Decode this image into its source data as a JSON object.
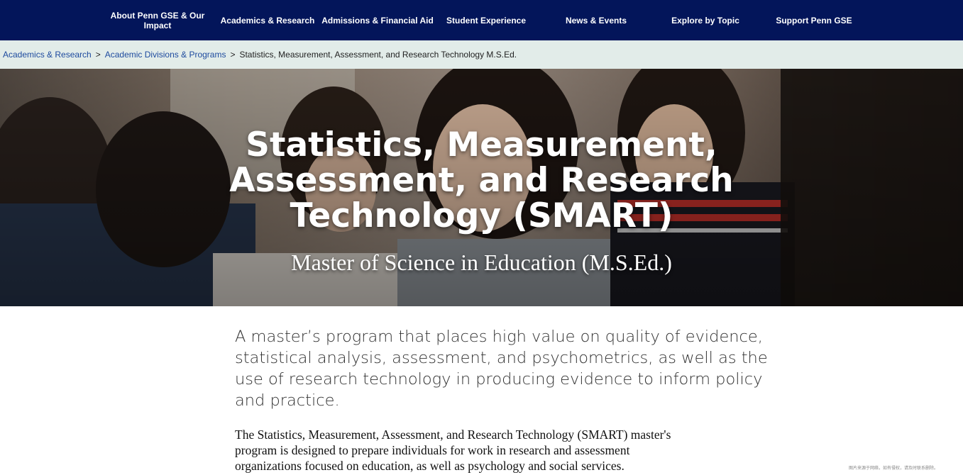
{
  "nav": {
    "items": [
      {
        "lines": [
          "About Penn GSE & Our",
          "Impact"
        ]
      },
      {
        "lines": [
          "Academics & Research"
        ]
      },
      {
        "lines": [
          "Admissions & Financial Aid"
        ]
      },
      {
        "lines": [
          "Student Experience"
        ]
      },
      {
        "lines": [
          "News & Events"
        ]
      },
      {
        "lines": [
          "Explore by Topic"
        ]
      },
      {
        "lines": [
          "Support Penn GSE"
        ]
      }
    ]
  },
  "breadcrumb": {
    "items": [
      "Academics & Research",
      "Academic Divisions & Programs"
    ],
    "separator": ">",
    "current": "Statistics, Measurement, Assessment, and Research Technology M.S.Ed."
  },
  "hero": {
    "title_lines": [
      "Statistics, Measurement,",
      "Assessment, and Research",
      "Technology (SMART)"
    ],
    "subtitle": "Master of Science in Education (M.S.Ed.)"
  },
  "content": {
    "lede_lines": [
      "A master’s program that places high value on quality of evidence,",
      "statistical analysis, assessment, and psychometrics, as well as the",
      "use of research technology in producing evidence to inform policy",
      "and practice."
    ],
    "body_lines": [
      "The Statistics, Measurement, Assessment, and Research Technology (SMART) master's",
      "program is designed to prepare individuals for work in research and assessment",
      "organizations focused on education, as well as psychology and social services."
    ]
  },
  "watermark": "图片来源于网络，如有侵权，请及时联系删除。",
  "colors": {
    "nav_bg": "#03155a",
    "breadcrumb_bg": "#e2ece9",
    "link": "#1d4a9e"
  }
}
